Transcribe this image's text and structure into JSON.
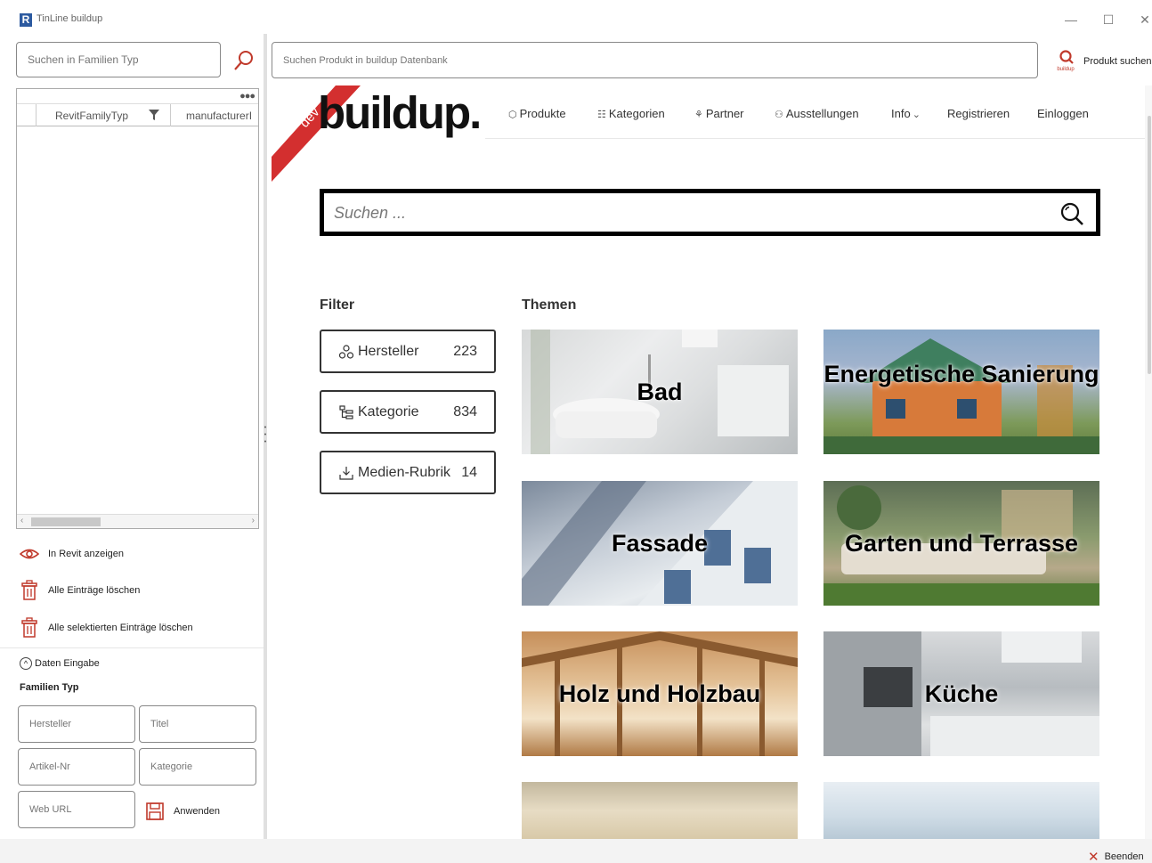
{
  "window": {
    "title": "TinLine buildup",
    "app_icon": "R"
  },
  "left_panel": {
    "search_placeholder": "Suchen in Familien Typ",
    "grid": {
      "columns": [
        "RevitFamilyTyp",
        "manufacturerI"
      ],
      "menu_dots": "●●●"
    },
    "actions": [
      {
        "label": "In Revit anzeigen",
        "icon": "eye-icon"
      },
      {
        "label": "Alle Einträge löschen",
        "icon": "trash-icon"
      },
      {
        "label": "Alle selektierten Einträge löschen",
        "icon": "trash-icon"
      }
    ],
    "daten_eingabe": "Daten Eingabe",
    "familien_typ": "Familien Typ",
    "fields": {
      "hersteller": "Hersteller",
      "titel": "Titel",
      "artikel_nr": "Artikel-Nr",
      "kategorie": "Kategorie",
      "web_url": "Web URL"
    },
    "apply_label": "Anwenden"
  },
  "top": {
    "db_search_placeholder": "Suchen Produkt in buildup Datenbank",
    "produkt_suchen": "Produkt suchen",
    "produkt_icon_text": "buildup"
  },
  "web": {
    "dev_ribbon": "dev",
    "logo": "buildup.",
    "nav": [
      "Produkte",
      "Kategorien",
      "Partner",
      "Ausstellungen",
      "Info",
      "Registrieren",
      "Einloggen"
    ],
    "search_placeholder": "Suchen ...",
    "filter_heading": "Filter",
    "themen_heading": "Themen",
    "filters": [
      {
        "label": "Hersteller",
        "count": "223",
        "icon": "partner-icon"
      },
      {
        "label": "Kategorie",
        "count": "834",
        "icon": "category-icon"
      },
      {
        "label": "Medien-Rubrik",
        "count": "14",
        "icon": "download-icon"
      }
    ],
    "themen": [
      {
        "label": "Bad"
      },
      {
        "label": "Energetische Sanierung"
      },
      {
        "label": "Fassade"
      },
      {
        "label": "Garten und Terrasse"
      },
      {
        "label": "Holz und Holzbau"
      },
      {
        "label": "Küche"
      }
    ]
  },
  "footer": {
    "beenden": "Beenden"
  },
  "colors": {
    "accent": "#c0392b",
    "ribbon": "#d32f2f"
  }
}
